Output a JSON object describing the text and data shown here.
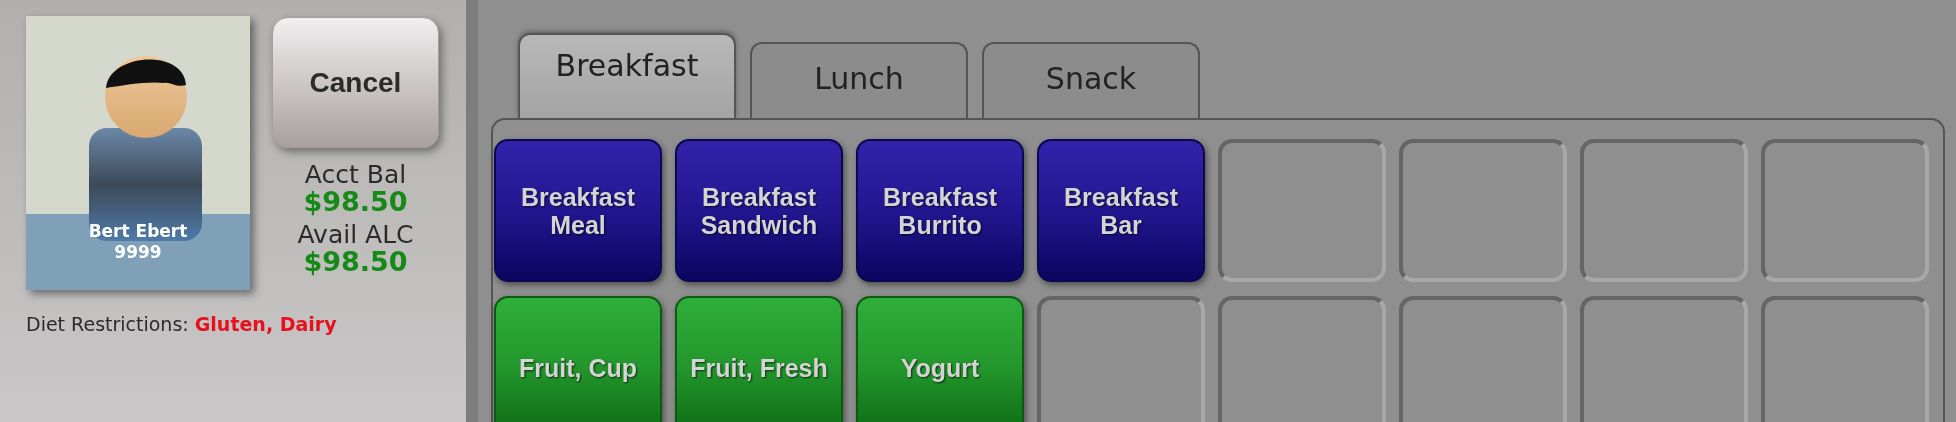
{
  "customer": {
    "name": "Bert Ebert",
    "id": "9999"
  },
  "cancel_button": "Cancel",
  "balances": [
    {
      "label": "Acct Bal",
      "amount": "$98.50"
    },
    {
      "label": "Avail ALC",
      "amount": "$98.50"
    }
  ],
  "diet_restrictions": {
    "label": "Diet Restrictions:",
    "value": "Gluten, Dairy"
  },
  "tabs": [
    {
      "label": "Breakfast",
      "selected": true
    },
    {
      "label": "Lunch",
      "selected": false
    },
    {
      "label": "Snack",
      "selected": false
    }
  ],
  "tiles": [
    {
      "kind": "entree",
      "label": "Breakfast Meal"
    },
    {
      "kind": "entree",
      "label": "Breakfast Sandwich"
    },
    {
      "kind": "entree",
      "label": "Breakfast Burrito"
    },
    {
      "kind": "entree",
      "label": "Breakfast Bar"
    },
    {
      "kind": "empty"
    },
    {
      "kind": "empty"
    },
    {
      "kind": "empty"
    },
    {
      "kind": "empty"
    },
    {
      "kind": "side",
      "label": "Fruit, Cup"
    },
    {
      "kind": "side",
      "label": "Fruit, Fresh"
    },
    {
      "kind": "side",
      "label": "Yogurt"
    },
    {
      "kind": "empty"
    },
    {
      "kind": "empty"
    },
    {
      "kind": "empty"
    },
    {
      "kind": "empty"
    },
    {
      "kind": "empty"
    }
  ]
}
